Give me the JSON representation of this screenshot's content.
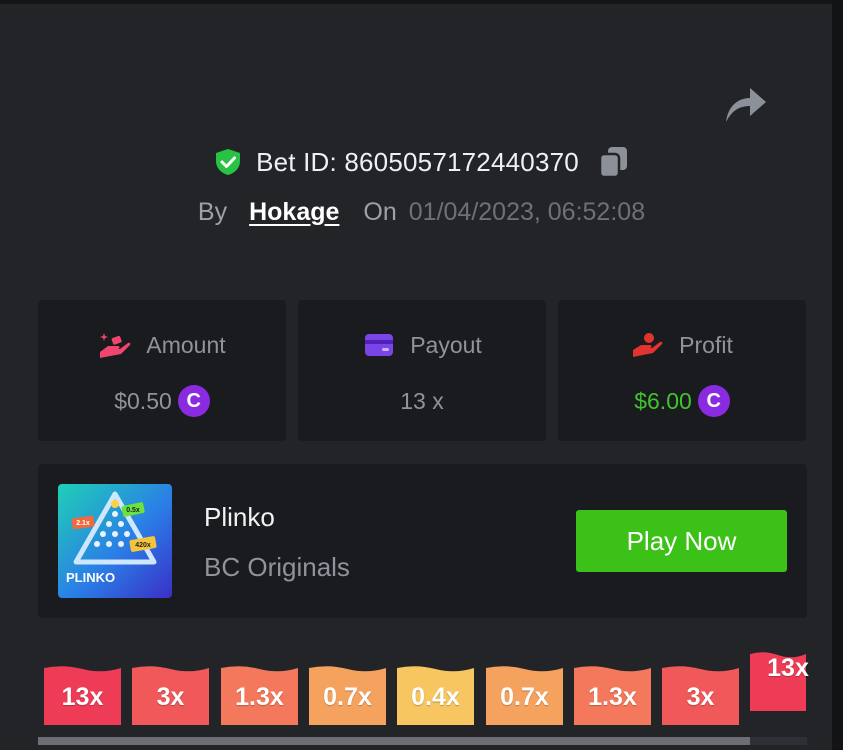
{
  "bet": {
    "id_text": "Bet ID: 8605057172440370",
    "by_label": "By",
    "user": "Hokage",
    "on_label": "On",
    "datetime": "01/04/2023, 06:52:08"
  },
  "icons": {
    "share": "share-arrow-icon",
    "verified": "shield-check-icon",
    "copy": "copy-icon",
    "amount": "hand-coins-icon",
    "payout": "wallet-card-icon",
    "profit": "hand-heart-icon",
    "currency": "coin-c-icon"
  },
  "stats": {
    "amount": {
      "label": "Amount",
      "value": "$0.50",
      "coin": "C"
    },
    "payout": {
      "label": "Payout",
      "value": "13 x"
    },
    "profit": {
      "label": "Profit",
      "value": "$6.00",
      "coin": "C"
    }
  },
  "game": {
    "title": "Plinko",
    "provider": "BC Originals",
    "play_label": "Play Now",
    "thumb_text": "PLINKO",
    "thumb_badges": [
      "2.1x",
      "0.5x",
      "420x"
    ]
  },
  "multipliers": [
    {
      "label": "13x",
      "color": "#ee3c56",
      "hit": false
    },
    {
      "label": "3x",
      "color": "#f0585a",
      "hit": false
    },
    {
      "label": "1.3x",
      "color": "#f4785c",
      "hit": false
    },
    {
      "label": "0.7x",
      "color": "#f6a25f",
      "hit": false
    },
    {
      "label": "0.4x",
      "color": "#f7c660",
      "hit": false
    },
    {
      "label": "0.7x",
      "color": "#f6a25f",
      "hit": false
    },
    {
      "label": "1.3x",
      "color": "#f4785c",
      "hit": false
    },
    {
      "label": "3x",
      "color": "#f0585a",
      "hit": false
    },
    {
      "label": "13x",
      "color": "#ee3c56",
      "hit": true
    }
  ],
  "colors": {
    "background": "#232428",
    "card": "#1a1b1e",
    "accent_green": "#3bc117",
    "profit_green": "#3fc52d",
    "coin_purple": "#8a2be2"
  }
}
